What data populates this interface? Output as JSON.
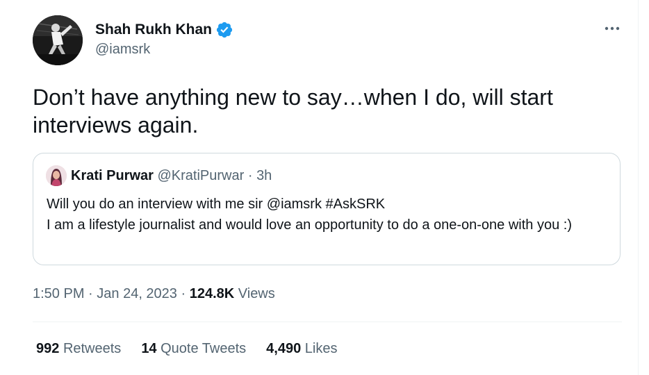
{
  "author": {
    "name": "Shah Rukh Khan",
    "handle": "@iamsrk",
    "verified_color": "#1d9bf0",
    "avatar_icon": "profile-photo"
  },
  "menu": {
    "more_icon": "ellipsis-icon"
  },
  "tweet": {
    "text": "Don’t have anything new to say…when I do, will start interviews again."
  },
  "quoted_tweet": {
    "name": "Krati Purwar",
    "handle": "@KratiPurwar",
    "separator": " · ",
    "time_ago": "3h",
    "text": "Will you do an interview with me sir @iamsrk #AskSRK\nI am a lifestyle journalist and would love an opportunity to do a one-on-one with you :)"
  },
  "meta": {
    "time": "1:50 PM",
    "date": "Jan 24, 2023",
    "separator": " · ",
    "views_count": "124.8K",
    "views_label": "Views"
  },
  "stats": {
    "retweets_count": "992",
    "retweets_label": "Retweets",
    "quotes_count": "14",
    "quotes_label": "Quote Tweets",
    "likes_count": "4,490",
    "likes_label": "Likes"
  },
  "colors": {
    "text_primary": "#0f1419",
    "text_secondary": "#536471",
    "border": "#cfd9de",
    "divider": "#eff3f4"
  }
}
